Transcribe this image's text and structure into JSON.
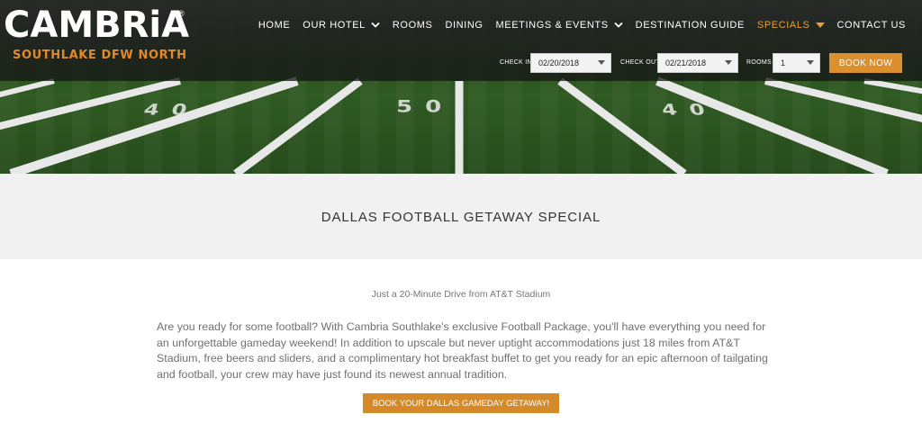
{
  "brand": {
    "name": "CAMBRiA",
    "registered": "®",
    "location": "SOUTHLAKE DFW NORTH",
    "accent_color": "#e08a2b"
  },
  "nav": {
    "items": [
      {
        "label": "HOME",
        "dropdown": false,
        "active": false
      },
      {
        "label": "OUR HOTEL",
        "dropdown": true,
        "active": false
      },
      {
        "label": "ROOMS",
        "dropdown": false,
        "active": false
      },
      {
        "label": "DINING",
        "dropdown": false,
        "active": false
      },
      {
        "label": "MEETINGS & EVENTS",
        "dropdown": true,
        "active": false
      },
      {
        "label": "DESTINATION GUIDE",
        "dropdown": false,
        "active": false
      },
      {
        "label": "SPECIALS",
        "dropdown": true,
        "active": true
      },
      {
        "label": "CONTACT US",
        "dropdown": false,
        "active": false
      }
    ]
  },
  "booking": {
    "check_in_label": "CHECK IN",
    "check_in_value": "02/20/2018",
    "check_out_label": "CHECK OUT",
    "check_out_value": "02/21/2018",
    "rooms_label": "ROOMS",
    "rooms_value": "1",
    "book_now": "BOOK NOW"
  },
  "hero": {
    "yard_numbers": [
      "40",
      "50",
      "40"
    ]
  },
  "page": {
    "title": "DALLAS FOOTBALL GETAWAY SPECIAL",
    "subtitle": "Just a 20-Minute Drive from AT&T Stadium",
    "body": "Are you ready for some football? With Cambria Southlake's exclusive Football Package, you'll have everything you need for an unforgettable gameday weekend! In addition to upscale but never uptight accommodations just 18 miles from AT&T Stadium, free beers and sliders, and a complimentary hot breakfast buffet to get you ready for an epic afternoon of tailgating and football, your crew may have just found its newest annual tradition.",
    "cta": "BOOK YOUR DALLAS GAMEDAY GETAWAY!"
  }
}
